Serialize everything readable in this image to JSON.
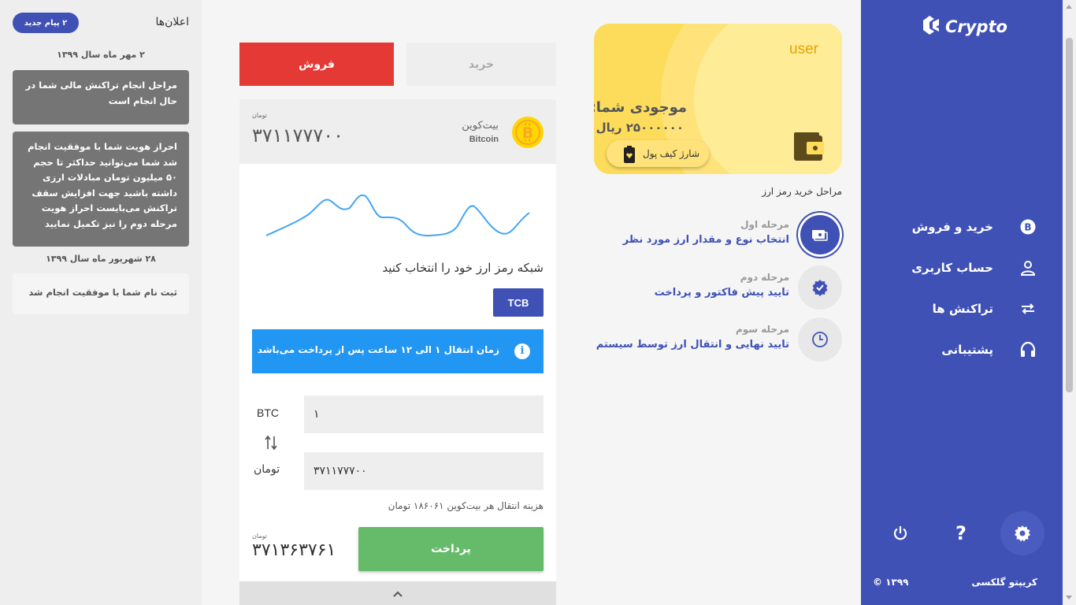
{
  "sidebar": {
    "logo_text": "Crypto",
    "nav": [
      {
        "label": "خرید و فروش",
        "icon": "bitcoin-icon"
      },
      {
        "label": "حساب کاربری",
        "icon": "user-icon"
      },
      {
        "label": "تراکنش ها",
        "icon": "swap-arrows-icon"
      },
      {
        "label": "پشتیبانی",
        "icon": "headset-icon"
      }
    ],
    "bottom_icons": [
      "settings-icon",
      "help-icon",
      "power-icon"
    ],
    "footer_brand": "کریپتو گلکسی",
    "footer_copyright": "© ۱۳۹۹"
  },
  "wallet": {
    "user": "user",
    "balance_label": "موجودی شما:",
    "balance_value": "۲۵۰۰۰۰۰۰ ریال",
    "charge_label": "شارژ کیف پول",
    "accent_color": "#fddc5c"
  },
  "steps": {
    "title": "مراحل خرید رمز ارز",
    "items": [
      {
        "title": "مرحله اول",
        "desc": "انتخاب نوع و مقدار ارز مورد نظر",
        "icon": "payment-icon",
        "active": true
      },
      {
        "title": "مرحله دوم",
        "desc": "تایید پیش فاکتور و پرداخت",
        "icon": "verified-icon",
        "active": false
      },
      {
        "title": "مرحله سوم",
        "desc": "تایید نهایی و انتقال ارز توسط سیستم",
        "icon": "clock-icon",
        "active": false
      }
    ]
  },
  "trade": {
    "tab_buy": "خرید",
    "tab_sell": "فروش",
    "coin_name": "بیت‌کوین",
    "coin_en": "Bitcoin",
    "price_unit": "تومان",
    "price": "۳۷۱۱۷۷۷۰۰",
    "network_title": "شبکه رمز ارز خود را انتخاب کنید",
    "network_option": "TCB",
    "info_text": "زمان انتقال ۱ الی ۱۲ ساعت پس از پرداخت می‌باشد",
    "btc_amount": "۱",
    "btc_unit": "BTC",
    "toman_amount": "۳۷۱۱۷۷۷۰۰",
    "toman_unit": "تومان",
    "fee_text": "هزینه انتقال هر بیت‌کوین ۱۸۶۰۶۱ تومان",
    "total_unit": "تومان",
    "total": "۳۷۱۳۶۳۷۶۱",
    "pay_label": "پرداخت",
    "sell_color": "#e53935",
    "pay_color": "#66bb6a"
  },
  "announcements": {
    "title": "اعلان‌ها",
    "badge": "۲ پیام جدید",
    "groups": [
      {
        "date": "۲ مهر ماه سال ۱۳۹۹",
        "messages": [
          "مراحل انجام تراکنش مالی شما در حال انجام است",
          "احراز هویت شما با موفقیت انجام شد شما می‌توانید حداکثر تا حجم ۵۰ میلیون تومان مبادلات ارزی داشته باشید جهت افزایش سقف تراکنش می‌بایست احراز هویت مرحله دوم را نیز تکمیل نمایید"
        ]
      },
      {
        "date": "۲۸ شهریور ماه سال ۱۳۹۹",
        "messages": [
          "ثبت نام شما با موفقیت انجام شد"
        ]
      }
    ]
  }
}
